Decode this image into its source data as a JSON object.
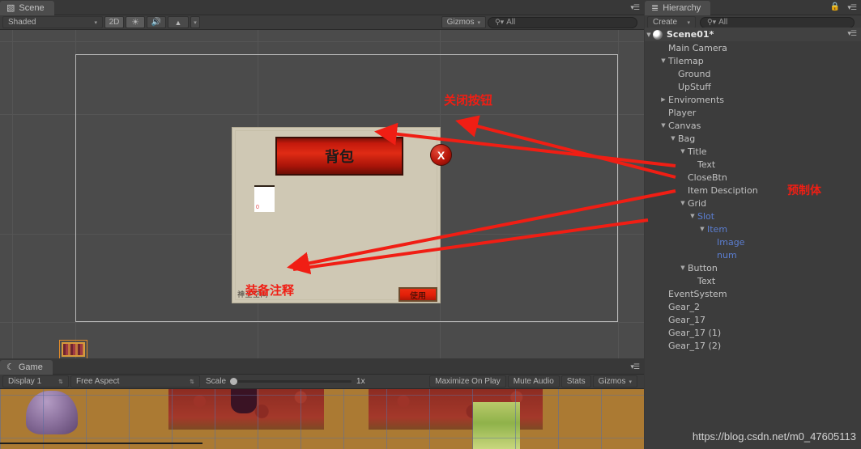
{
  "scene_panel": {
    "tab_label": "Scene",
    "tab_icon": "scene-grid-icon",
    "toolbar": {
      "shading_mode": "Shaded",
      "mode_2d": "2D",
      "lighting_icon": "sun-icon",
      "audio_icon": "speaker-icon",
      "effects_icon": "image-effects-icon",
      "gizmos_label": "Gizmos",
      "search_placeholder": "All",
      "search_value": "",
      "search_icon": "search-icon"
    },
    "bag_ui": {
      "title": "背包",
      "close_button": "X",
      "slot_count_value": "0",
      "item_description": "神圣空间",
      "use_button": "使用"
    },
    "annotations": [
      {
        "id": "anno-close",
        "text": "关闭按钮"
      },
      {
        "id": "anno-equip",
        "text": "装备注释"
      },
      {
        "id": "anno-prefab",
        "text": "预制体"
      }
    ],
    "annotation_color": "#f01e14"
  },
  "game_panel": {
    "tab_label": "Game",
    "tab_icon": "game-controller-icon",
    "toolbar": {
      "display": "Display 1",
      "aspect": "Free Aspect",
      "scale_label": "Scale",
      "scale_value": "1x",
      "maximize_on_play": "Maximize On Play",
      "mute_audio": "Mute Audio",
      "stats": "Stats",
      "gizmos": "Gizmos"
    }
  },
  "hierarchy_panel": {
    "tab_label": "Hierarchy",
    "tab_icon": "hierarchy-list-icon",
    "lock_icon": "lock-icon",
    "menu_icon": "panel-menu-icon",
    "create_label": "Create",
    "search_placeholder": "All",
    "search_value": "",
    "scene_name": "Scene01*",
    "items": [
      {
        "label": "Main Camera",
        "depth": 1,
        "tri": "none",
        "prefab": false
      },
      {
        "label": "Tilemap",
        "depth": 1,
        "tri": "open",
        "prefab": false
      },
      {
        "label": "Ground",
        "depth": 2,
        "tri": "none",
        "prefab": false
      },
      {
        "label": "UpStuff",
        "depth": 2,
        "tri": "none",
        "prefab": false
      },
      {
        "label": "Enviroments",
        "depth": 1,
        "tri": "closed",
        "prefab": false
      },
      {
        "label": "Player",
        "depth": 1,
        "tri": "none",
        "prefab": false
      },
      {
        "label": "Canvas",
        "depth": 1,
        "tri": "open",
        "prefab": false
      },
      {
        "label": "Bag",
        "depth": 2,
        "tri": "open",
        "prefab": false
      },
      {
        "label": "Title",
        "depth": 3,
        "tri": "open",
        "prefab": false
      },
      {
        "label": "Text",
        "depth": 4,
        "tri": "none",
        "prefab": false
      },
      {
        "label": "CloseBtn",
        "depth": 3,
        "tri": "none",
        "prefab": false
      },
      {
        "label": "Item Desciption",
        "depth": 3,
        "tri": "none",
        "prefab": false
      },
      {
        "label": "Grid",
        "depth": 3,
        "tri": "open",
        "prefab": false
      },
      {
        "label": "Slot",
        "depth": 4,
        "tri": "open",
        "prefab": true,
        "selected_outline": true
      },
      {
        "label": "Item",
        "depth": 5,
        "tri": "open",
        "prefab": true
      },
      {
        "label": "Image",
        "depth": 6,
        "tri": "none",
        "prefab": true
      },
      {
        "label": "num",
        "depth": 6,
        "tri": "none",
        "prefab": true
      },
      {
        "label": "Button",
        "depth": 3,
        "tri": "open",
        "prefab": false
      },
      {
        "label": "Text",
        "depth": 4,
        "tri": "none",
        "prefab": false
      },
      {
        "label": "EventSystem",
        "depth": 1,
        "tri": "none",
        "prefab": false
      },
      {
        "label": "Gear_2",
        "depth": 1,
        "tri": "none",
        "prefab": false
      },
      {
        "label": "Gear_17",
        "depth": 1,
        "tri": "none",
        "prefab": false
      },
      {
        "label": "Gear_17 (1)",
        "depth": 1,
        "tri": "none",
        "prefab": false
      },
      {
        "label": "Gear_17 (2)",
        "depth": 1,
        "tri": "none",
        "prefab": false
      }
    ]
  },
  "watermark": {
    "text": "https://blog.csdn.net/m0_47605113"
  }
}
